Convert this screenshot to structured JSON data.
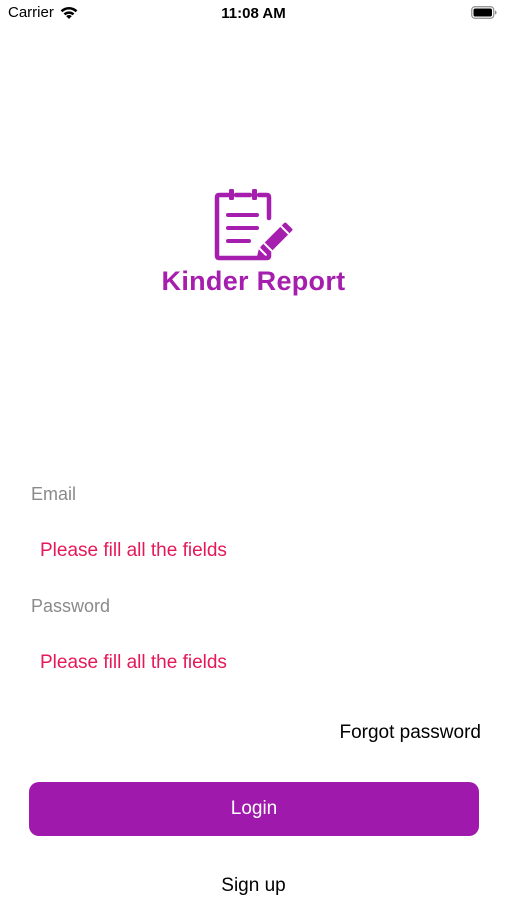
{
  "status_bar": {
    "carrier": "Carrier",
    "time": "11:08 AM",
    "wifi_icon": "wifi-icon",
    "battery_icon": "battery-icon"
  },
  "brand": {
    "app_name": "Kinder Report",
    "logo_icon": "clipboard-crayon-icon",
    "color": "#a51ead"
  },
  "form": {
    "email": {
      "label": "Email",
      "value": "",
      "error": "Please fill all the fields"
    },
    "password": {
      "label": "Password",
      "value": "",
      "error": "Please fill all the fields"
    },
    "forgot_password": "Forgot password",
    "login_button": "Login",
    "signup_link": "Sign up",
    "error_color": "#e5195a",
    "button_color": "#a019ad"
  }
}
